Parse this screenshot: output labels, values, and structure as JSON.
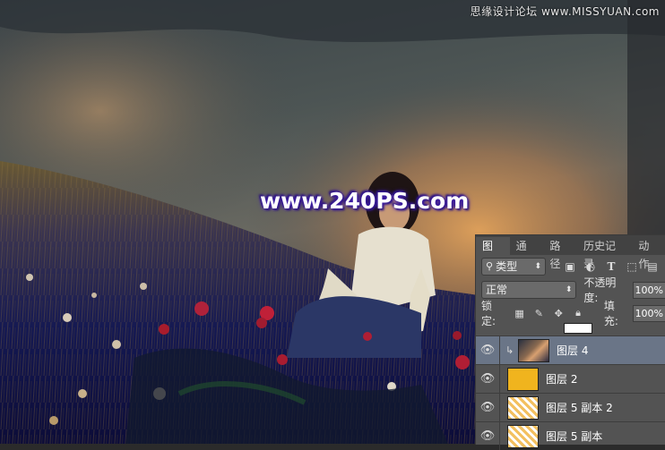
{
  "watermark_top": "思缘设计论坛 www.MISSYUAN.com",
  "watermark_center": "www.240PS.com",
  "panel": {
    "tabs": [
      "图层",
      "通道",
      "路径",
      "历史记录",
      "动作"
    ],
    "filter_kind": "类型",
    "blend_mode": "正常",
    "opacity_label": "不透明度:",
    "opacity_value": "100%",
    "lock_label": "锁定:",
    "fill_label": "填充:",
    "fill_value": "100%",
    "layers": [
      {
        "name": "图层 4",
        "selected": true,
        "thumb": "photo"
      },
      {
        "name": "图层 2",
        "selected": false,
        "thumb": "yellow"
      },
      {
        "name": "图层 5 副本 2",
        "selected": false,
        "thumb": "checker"
      },
      {
        "name": "图层 5 副本",
        "selected": false,
        "thumb": "checker"
      }
    ]
  },
  "colors": {
    "panel_bg": "#535353",
    "selected_layer": "#6a7587",
    "watermark_glow": "#3a1ea0"
  }
}
